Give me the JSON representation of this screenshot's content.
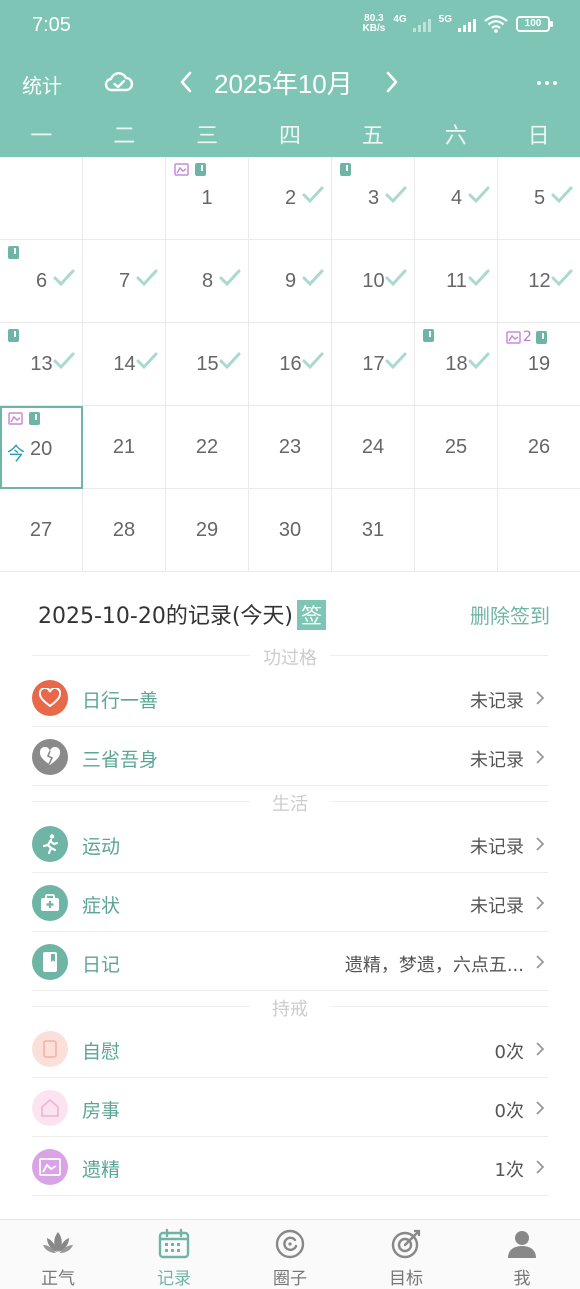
{
  "status_bar": {
    "time": "7:05",
    "net_speed_value": "80.3",
    "net_speed_unit": "KB/s",
    "sig1_label": "4G",
    "sig2_label": "5G",
    "battery": "100"
  },
  "header": {
    "stats_label": "统计",
    "month_title": "2025年10月",
    "weekdays": [
      "一",
      "二",
      "三",
      "四",
      "五",
      "六",
      "日"
    ]
  },
  "calendar": {
    "today_label": "今",
    "days": [
      "1",
      "2",
      "3",
      "4",
      "5",
      "6",
      "7",
      "8",
      "9",
      "10",
      "11",
      "12",
      "13",
      "14",
      "15",
      "16",
      "17",
      "18",
      "19",
      "20",
      "21",
      "22",
      "23",
      "24",
      "25",
      "26",
      "27",
      "28",
      "29",
      "30",
      "31"
    ],
    "day19_count": "2"
  },
  "records": {
    "title": "2025-10-20的记录(今天)",
    "sign_badge": "签",
    "delete_signin": "删除签到",
    "sections": {
      "merit": "功过格",
      "life": "生活",
      "precepts": "持戒"
    },
    "items": [
      {
        "name": "日行一善",
        "value": "未记录"
      },
      {
        "name": "三省吾身",
        "value": "未记录"
      },
      {
        "name": "运动",
        "value": "未记录"
      },
      {
        "name": "症状",
        "value": "未记录"
      },
      {
        "name": "日记",
        "value": "遗精，梦遗，六点五..."
      },
      {
        "name": "自慰",
        "value": "0次"
      },
      {
        "name": "房事",
        "value": "0次"
      },
      {
        "name": "遗精",
        "value": "1次"
      }
    ]
  },
  "bottom_nav": {
    "tabs": [
      "正气",
      "记录",
      "圈子",
      "目标",
      "我"
    ]
  },
  "colors": {
    "primary": "#7ec5b6",
    "accent_text": "#5aa596",
    "today_border": "#6fb5a6",
    "good_deed": "#e8684a",
    "reflection": "#8a8a8a",
    "diary": "#6fb5a6",
    "masturbation": "#f8d0c8",
    "intercourse": "#f6d6e8",
    "emission": "#c98ad8"
  }
}
